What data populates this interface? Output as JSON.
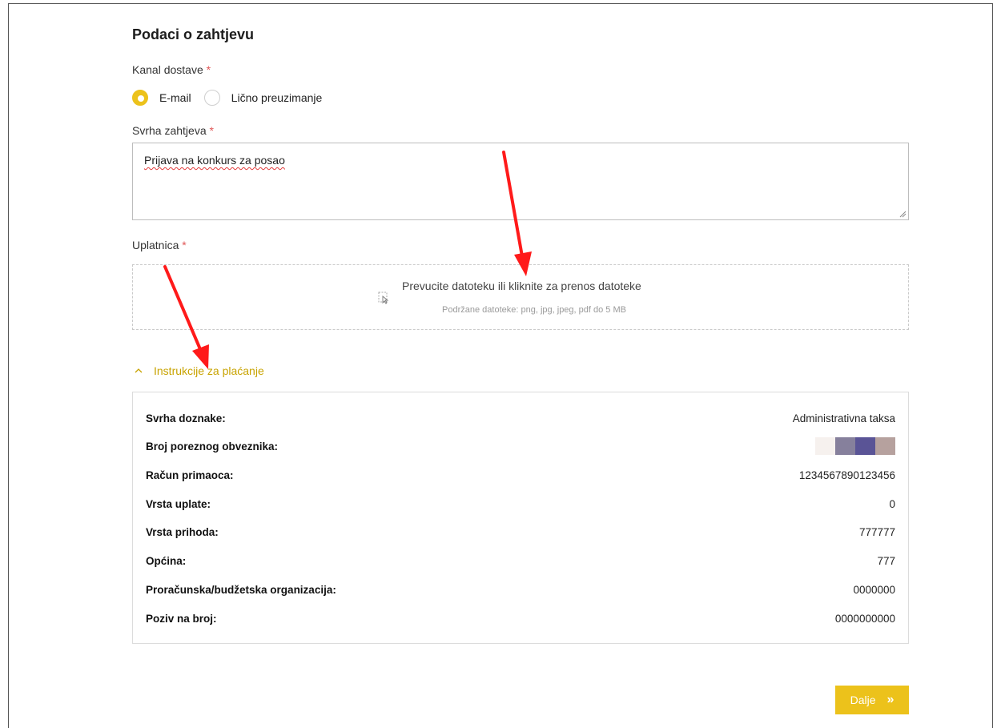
{
  "form": {
    "title": "Podaci o zahtjevu",
    "delivery": {
      "label": "Kanal dostave",
      "required_mark": "*",
      "options": [
        {
          "label": "E-mail",
          "selected": true
        },
        {
          "label": "Lično preuzimanje",
          "selected": false
        }
      ]
    },
    "purpose": {
      "label": "Svrha zahtjeva",
      "required_mark": "*",
      "value": "Prijava na konkurs za posao"
    },
    "upload": {
      "label": "Uplatnica",
      "required_mark": "*",
      "prompt": "Prevucite datoteku ili kliknite za prenos datoteke",
      "hint": "Podržane datoteke: png, jpg, jpeg, pdf do 5 MB",
      "icon": "file-upload-icon"
    },
    "instructions": {
      "toggle_label": "Instrukcije za plaćanje",
      "expanded": true,
      "rows": [
        {
          "key": "Svrha doznake:",
          "value": "Administrativna taksa"
        },
        {
          "key": "Broj poreznog obveznika:",
          "value": "",
          "redacted": true
        },
        {
          "key": "Račun primaoca:",
          "value": "1234567890123456"
        },
        {
          "key": "Vrsta uplate:",
          "value": "0"
        },
        {
          "key": "Vrsta prihoda:",
          "value": "777777"
        },
        {
          "key": "Općina:",
          "value": "777"
        },
        {
          "key": "Proračunska/budžetska organizacija:",
          "value": "0000000"
        },
        {
          "key": "Poziv na broj:",
          "value": "0000000000"
        }
      ]
    },
    "next_button": {
      "label": "Dalje",
      "icon": "double-chevron-right-icon"
    }
  },
  "colors": {
    "accent": "#ecc21b",
    "link": "#c8a300",
    "required": "#e05656",
    "annotation_arrow": "#ff1a1a",
    "redaction_blocks": [
      "#f6f1ee",
      "#86809c",
      "#5a5496",
      "#b6a19e"
    ]
  }
}
